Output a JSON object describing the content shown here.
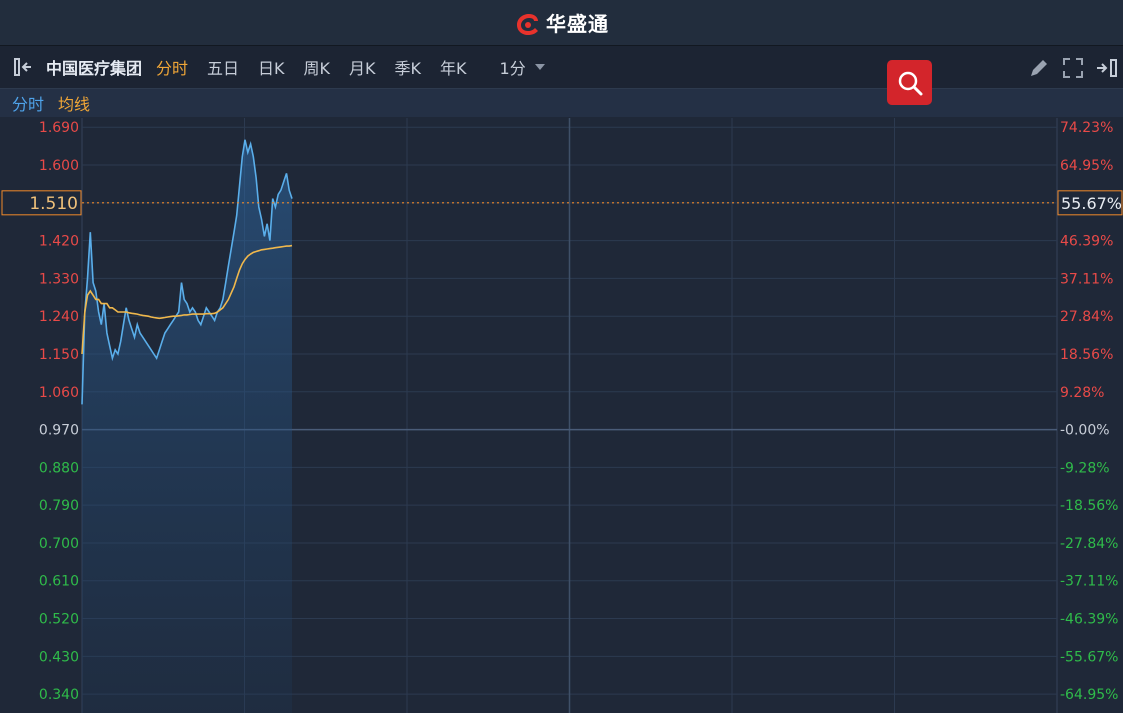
{
  "app": {
    "brand": "华盛通",
    "brand_color": "#e8322c"
  },
  "toolbar": {
    "stock_name": "中国医疗集团",
    "tabs": [
      "分时",
      "五日",
      "日K",
      "周K",
      "月K",
      "季K",
      "年K"
    ],
    "active_tab": 0,
    "period": "1分",
    "icons": [
      "collapse-left-icon",
      "search-icon",
      "pencil-icon",
      "fullscreen-icon",
      "collapse-right-icon"
    ]
  },
  "legend": {
    "intraday": "分时",
    "average": "均线"
  },
  "colors": {
    "price_line": "#5aaeea",
    "avg_line": "#f0b84c",
    "up": "#e84a48",
    "down": "#2fbb4a",
    "neutral": "#c8ced8",
    "crosshair": "#f08a2a"
  },
  "chart_data": {
    "type": "line",
    "prev_close": 0.97,
    "ylim": [
      0.295,
      1.712
    ],
    "y_ticks": [
      "1.690",
      "1.600",
      "1.510",
      "1.420",
      "1.330",
      "1.240",
      "1.150",
      "1.060",
      "0.970",
      "0.880",
      "0.790",
      "0.700",
      "0.610",
      "0.520",
      "0.430",
      "0.340"
    ],
    "pct_ticks": [
      "74.23%",
      "64.95%",
      "55.67%",
      "46.39%",
      "37.11%",
      "27.84%",
      "18.56%",
      "9.28%",
      "-0.00%",
      "-9.28%",
      "-18.56%",
      "-27.84%",
      "-37.11%",
      "-46.39%",
      "-55.67%",
      "-64.95%"
    ],
    "crosshair": {
      "price": "1.510",
      "pct": "55.67%"
    },
    "total_minutes": 330,
    "series": [
      {
        "values": [
          1.03,
          1.25,
          1.33,
          1.44,
          1.32,
          1.3,
          1.25,
          1.22,
          1.27,
          1.2,
          1.17,
          1.14,
          1.16,
          1.15,
          1.18,
          1.22,
          1.26,
          1.23,
          1.21,
          1.19,
          1.22,
          1.2,
          1.19,
          1.18,
          1.17,
          1.16,
          1.15,
          1.14,
          1.16,
          1.18,
          1.2,
          1.21,
          1.22,
          1.23,
          1.24,
          1.25,
          1.32,
          1.28,
          1.27,
          1.25,
          1.26,
          1.25,
          1.23,
          1.22,
          1.24,
          1.26,
          1.25,
          1.24,
          1.23,
          1.25,
          1.26,
          1.28,
          1.32,
          1.36,
          1.4,
          1.44,
          1.48,
          1.55,
          1.62,
          1.66,
          1.63,
          1.65,
          1.62,
          1.57,
          1.5,
          1.47,
          1.43,
          1.46,
          1.42,
          1.52,
          1.5,
          1.53,
          1.54,
          1.56,
          1.58,
          1.54,
          1.52
        ]
      },
      {
        "values": [
          1.15,
          1.25,
          1.29,
          1.3,
          1.29,
          1.28,
          1.28,
          1.27,
          1.27,
          1.27,
          1.26,
          1.26,
          1.255,
          1.25,
          1.25,
          1.25,
          1.25,
          1.248,
          1.247,
          1.246,
          1.245,
          1.243,
          1.242,
          1.241,
          1.24,
          1.238,
          1.237,
          1.236,
          1.235,
          1.236,
          1.237,
          1.238,
          1.239,
          1.24,
          1.24,
          1.241,
          1.242,
          1.243,
          1.243,
          1.244,
          1.245,
          1.245,
          1.245,
          1.245,
          1.245,
          1.246,
          1.246,
          1.246,
          1.247,
          1.25,
          1.255,
          1.26,
          1.27,
          1.28,
          1.295,
          1.31,
          1.33,
          1.35,
          1.365,
          1.375,
          1.383,
          1.388,
          1.392,
          1.394,
          1.396,
          1.398,
          1.399,
          1.4,
          1.401,
          1.402,
          1.403,
          1.404,
          1.405,
          1.406,
          1.407,
          1.407,
          1.408
        ]
      }
    ]
  }
}
